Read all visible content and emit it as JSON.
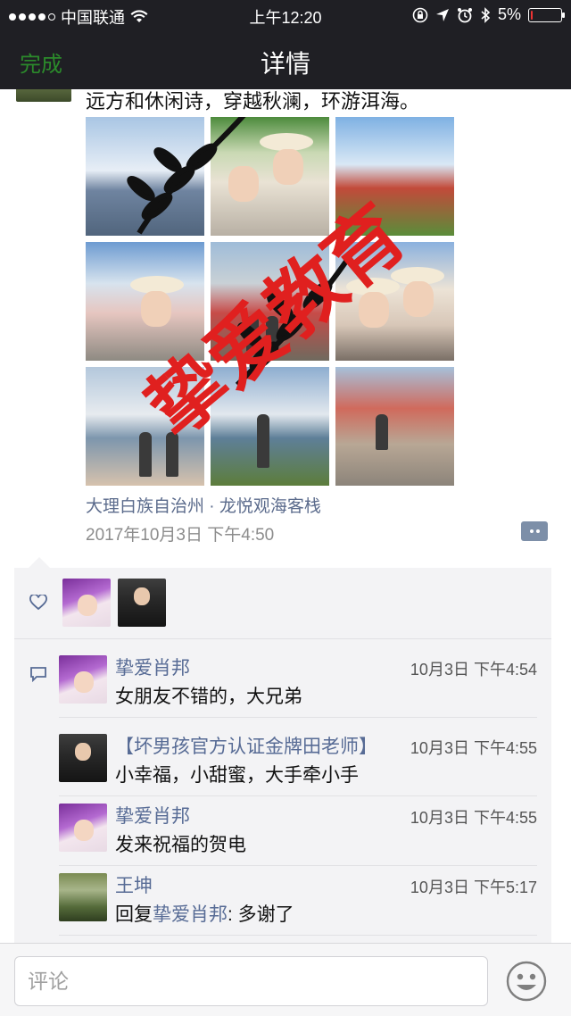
{
  "status_bar": {
    "carrier": "中国联通",
    "time": "上午12:20",
    "battery": "5%",
    "battery_level": 0.05
  },
  "nav": {
    "done_label": "完成",
    "title": "详情"
  },
  "post": {
    "text": "远方和休闲诗，穿越秋澜，环游洱海。",
    "watermark": "挚爱教育",
    "location": "大理白族自治州 · 龙悦观海客栈",
    "time": "2017年10月3日 下午4:50"
  },
  "comments": [
    {
      "name": "挚爱肖邦",
      "time": "10月3日 下午4:54",
      "text": "女朋友不错的，大兄弟"
    },
    {
      "name": "【坏男孩官方认证金牌田老师】",
      "time": "10月3日 下午4:55",
      "text": "小幸福，小甜蜜，大手牵小手"
    },
    {
      "name": "挚爱肖邦",
      "time": "10月3日 下午4:55",
      "text": "发来祝福的贺电"
    },
    {
      "name": "王坤",
      "time": "10月3日 下午5:17",
      "reply_prefix": "回复",
      "reply_to": "挚爱肖邦",
      "reply_text": ": 多谢了"
    }
  ],
  "input": {
    "placeholder": "评论"
  },
  "colors": {
    "nav_bg": "#1f1f24",
    "done_green": "#2b8a2b",
    "link_blue": "#576b95",
    "watermark_red": "#e0201f"
  }
}
